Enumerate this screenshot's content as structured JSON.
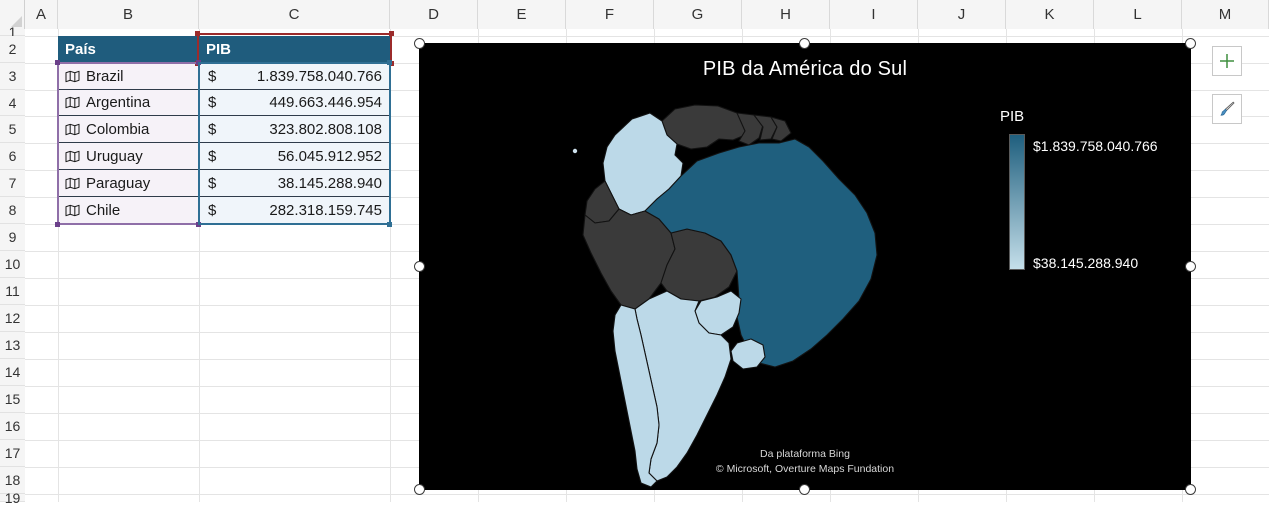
{
  "sheet": {
    "column_headers": [
      "A",
      "B",
      "C",
      "D",
      "E",
      "F",
      "G",
      "H",
      "I",
      "J",
      "K",
      "L",
      "M"
    ],
    "row_headers": [
      "1",
      "2",
      "3",
      "4",
      "5",
      "6",
      "7",
      "8",
      "9",
      "10",
      "11",
      "12",
      "13",
      "14",
      "15",
      "16",
      "17",
      "18",
      "19"
    ]
  },
  "table": {
    "headers": [
      "País",
      "PIB"
    ],
    "currency_symbol": "$",
    "rows": [
      {
        "country": "Brazil",
        "value": "1.839.758.040.766"
      },
      {
        "country": "Argentina",
        "value": "449.663.446.954"
      },
      {
        "country": "Colombia",
        "value": "323.802.808.108"
      },
      {
        "country": "Uruguay",
        "value": "56.045.912.952"
      },
      {
        "country": "Paraguay",
        "value": "38.145.288.940"
      },
      {
        "country": "Chile",
        "value": "282.318.159.745"
      }
    ]
  },
  "chart": {
    "title": "PIB da América do Sul",
    "legend": {
      "title": "PIB",
      "max_label": "$1.839.758.040.766",
      "min_label": "$38.145.288.940",
      "color_high": "#1f5f7e",
      "color_low": "#c5dfea"
    },
    "attribution_line1": "Da plataforma Bing",
    "attribution_line2": "© Microsoft, Overture Maps Fundation",
    "background": "#000000",
    "unmapped_color": "#3a3a3a"
  },
  "chart_data": {
    "type": "map",
    "title": "PIB da América do Sul",
    "legend_title": "PIB",
    "categories": [
      "Brazil",
      "Argentina",
      "Colombia",
      "Uruguay",
      "Paraguay",
      "Chile"
    ],
    "values": [
      1839758040766,
      449663446954,
      323802808108,
      56045912952,
      38145288940,
      282318159745
    ],
    "value_labels": [
      "$1.839.758.040.766",
      "$449.663.446.954",
      "$323.802.808.108",
      "$56.045.912.952",
      "$38.145.288.940",
      "$282.318.159.745"
    ],
    "scale_min": 38145288940,
    "scale_max": 1839758040766,
    "scale_min_label": "$38.145.288.940",
    "scale_max_label": "$1.839.758.040.766",
    "color_high": "#1f5f7e",
    "color_low": "#c5dfea",
    "no_data_color": "#3a3a3a",
    "region": "South America",
    "unmapped_regions": [
      "Venezuela",
      "Guyana",
      "Suriname",
      "French Guiana",
      "Ecuador",
      "Peru",
      "Bolivia"
    ]
  },
  "float_buttons": {
    "add_label": "+",
    "add_color": "#3f8f3f",
    "brush_color": "#4a90c4"
  }
}
